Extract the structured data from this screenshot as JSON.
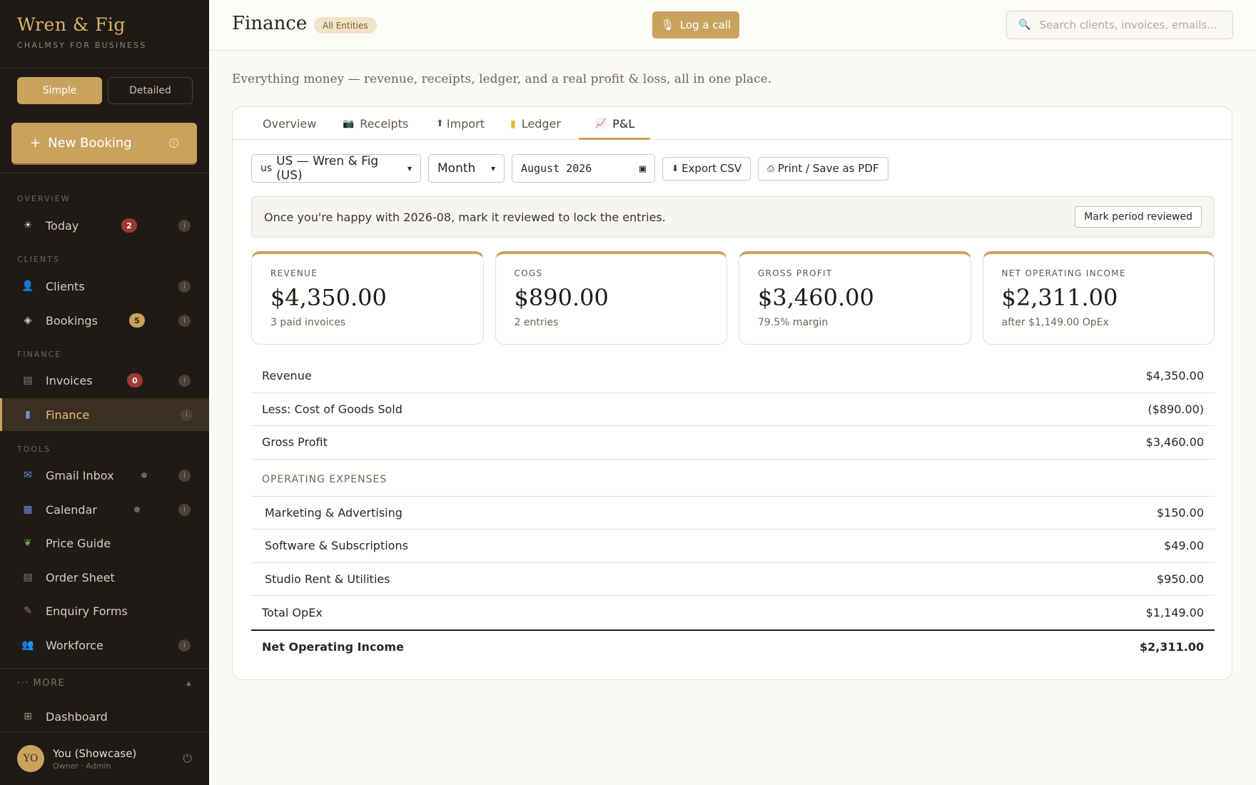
{
  "brand": {
    "name": "Wren & Fig",
    "subtitle": "CHALMSY FOR BUSINESS"
  },
  "mode": {
    "simple": "Simple",
    "detailed": "Detailed"
  },
  "new_booking": {
    "label": "New Booking",
    "plus": "+"
  },
  "sections": {
    "overview": "OVERVIEW",
    "clients": "CLIENTS",
    "finance": "FINANCE",
    "tools": "TOOLS"
  },
  "nav": {
    "today": {
      "label": "Today",
      "badge": "2"
    },
    "clients": {
      "label": "Clients"
    },
    "bookings": {
      "label": "Bookings",
      "badge": "5"
    },
    "invoices": {
      "label": "Invoices",
      "badge": "0"
    },
    "finance": {
      "label": "Finance"
    },
    "gmail": {
      "label": "Gmail Inbox"
    },
    "calendar": {
      "label": "Calendar"
    },
    "price_guide": {
      "label": "Price Guide"
    },
    "order_sheet": {
      "label": "Order Sheet"
    },
    "enquiry_forms": {
      "label": "Enquiry Forms"
    },
    "workforce": {
      "label": "Workforce"
    },
    "dashboard": {
      "label": "Dashboard"
    }
  },
  "more": {
    "label": "··· MORE",
    "caret": "▴"
  },
  "user": {
    "initials": "YO",
    "name": "You (Showcase)",
    "role": "Owner · Admin"
  },
  "topbar": {
    "title": "Finance",
    "entity": "All Entities",
    "log_call": "Log a call",
    "search_placeholder": "Search clients, invoices, emails..."
  },
  "intro": "Everything money — revenue, receipts, ledger, and a real profit & loss, all in one place.",
  "tabs": {
    "overview": "Overview",
    "receipts": "Receipts",
    "import": "Import",
    "ledger": "Ledger",
    "pl": "P&L"
  },
  "controls": {
    "entity": "US — Wren & Fig (US)",
    "entity_prefix": "us",
    "period": "Month",
    "date": "August 2026",
    "export": "Export CSV",
    "print": "Print / Save as PDF"
  },
  "review": {
    "message": "Once you're happy with 2026-08, mark it reviewed to lock the entries.",
    "button": "Mark period reviewed"
  },
  "kpis": [
    {
      "label": "REVENUE",
      "value": "$4,350.00",
      "sub": "3 paid invoices"
    },
    {
      "label": "COGS",
      "value": "$890.00",
      "sub": "2 entries"
    },
    {
      "label": "GROSS PROFIT",
      "value": "$3,460.00",
      "sub": "79.5% margin"
    },
    {
      "label": "NET OPERATING INCOME",
      "value": "$2,311.00",
      "sub": "after $1,149.00 OpEx"
    }
  ],
  "pl": {
    "revenue": {
      "label": "Revenue",
      "value": "$4,350.00"
    },
    "cogs": {
      "label": "Less: Cost of Goods Sold",
      "value": "($890.00)"
    },
    "gross": {
      "label": "Gross Profit",
      "value": "$3,460.00"
    },
    "opex_heading": "OPERATING EXPENSES",
    "opex": [
      {
        "label": "Marketing & Advertising",
        "value": "$150.00"
      },
      {
        "label": "Software & Subscriptions",
        "value": "$49.00"
      },
      {
        "label": "Studio Rent & Utilities",
        "value": "$950.00"
      }
    ],
    "total_opex": {
      "label": "Total OpEx",
      "value": "$1,149.00"
    },
    "net": {
      "label": "Net Operating Income",
      "value": "$2,311.00"
    }
  },
  "colors": {
    "accent": "#c9a35e",
    "sidebar": "#1f1a16",
    "badge_red": "#9b3a32"
  }
}
